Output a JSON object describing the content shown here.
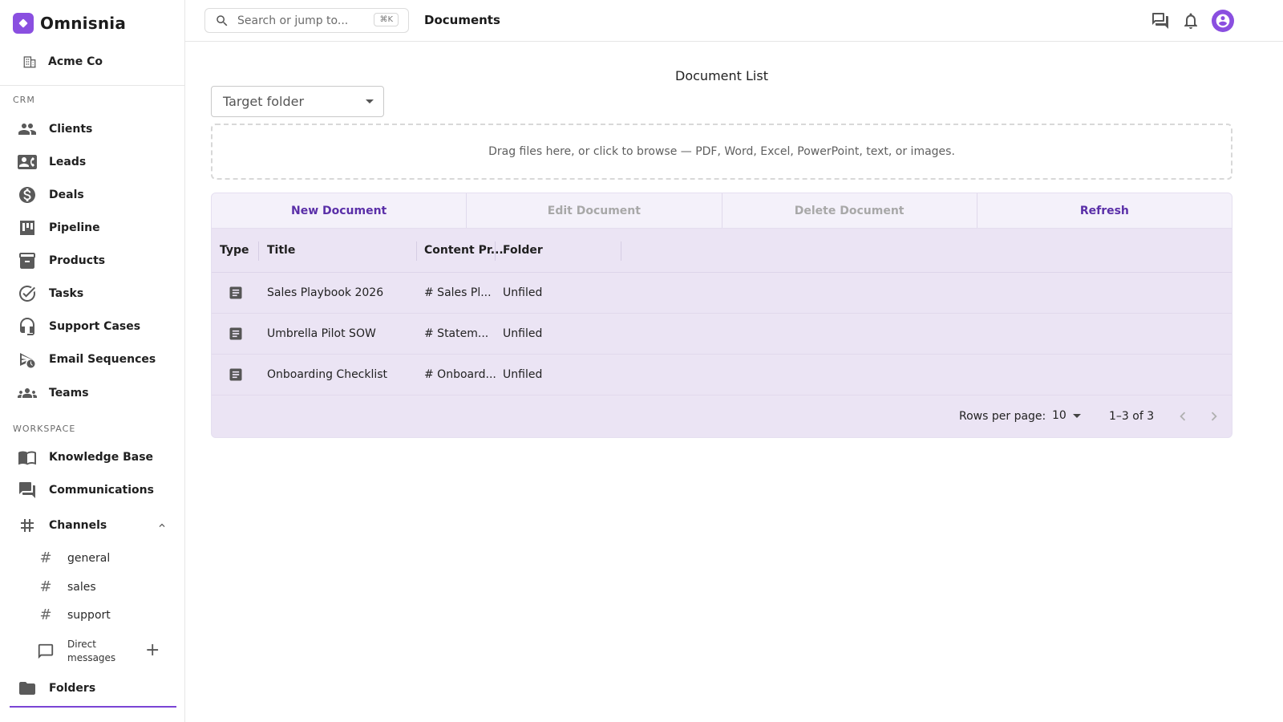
{
  "app": {
    "name": "Omnisnia",
    "org": "Acme Co"
  },
  "sidebar": {
    "crm_label": "CRM",
    "crm_items": [
      {
        "label": "Clients",
        "icon": "people-icon"
      },
      {
        "label": "Leads",
        "icon": "contact-card-icon"
      },
      {
        "label": "Deals",
        "icon": "dollar-icon"
      },
      {
        "label": "Pipeline",
        "icon": "kanban-icon"
      },
      {
        "label": "Products",
        "icon": "archive-box-icon"
      },
      {
        "label": "Tasks",
        "icon": "check-circle-icon"
      },
      {
        "label": "Support Cases",
        "icon": "headset-icon"
      },
      {
        "label": "Email Sequences",
        "icon": "scheduled-send-icon"
      },
      {
        "label": "Teams",
        "icon": "groups-icon"
      }
    ],
    "workspace_label": "WORKSPACE",
    "workspace_items": [
      {
        "label": "Knowledge Base",
        "icon": "book-icon"
      },
      {
        "label": "Communications",
        "icon": "forum-icon"
      },
      {
        "label": "Channels",
        "icon": "hash-icon"
      }
    ],
    "channels": [
      "general",
      "sales",
      "support"
    ],
    "direct_messages_label": "Direct messages",
    "folders_label": "Folders"
  },
  "topbar": {
    "search_placeholder": "Search or jump to...",
    "search_shortcut": "⌘K",
    "page_title": "Documents"
  },
  "main": {
    "title": "Document List",
    "folder_select_placeholder": "Target folder",
    "dropzone_text": "Drag files here, or click to browse — PDF, Word, Excel, PowerPoint, text, or images.",
    "actions": [
      {
        "label": "New Document",
        "enabled": true
      },
      {
        "label": "Edit Document",
        "enabled": false
      },
      {
        "label": "Delete Document",
        "enabled": false
      },
      {
        "label": "Refresh",
        "enabled": true
      }
    ],
    "table": {
      "columns": [
        "Type",
        "Title",
        "Content Pr...",
        "Folder"
      ],
      "rows": [
        {
          "title": "Sales Playbook 2026",
          "content": "# Sales Pl...",
          "folder": "Unfiled"
        },
        {
          "title": "Umbrella Pilot SOW",
          "content": "# Statem...",
          "folder": "Unfiled"
        },
        {
          "title": "Onboarding Checklist",
          "content": "# Onboard...",
          "folder": "Unfiled"
        }
      ],
      "rows_per_page_label": "Rows per page:",
      "rows_per_page": "10",
      "range": "1–3 of 3"
    }
  },
  "colors": {
    "accent": "#8a4fe0",
    "action_text": "#5a2fa8",
    "table_bg": "#ebe4f4"
  }
}
